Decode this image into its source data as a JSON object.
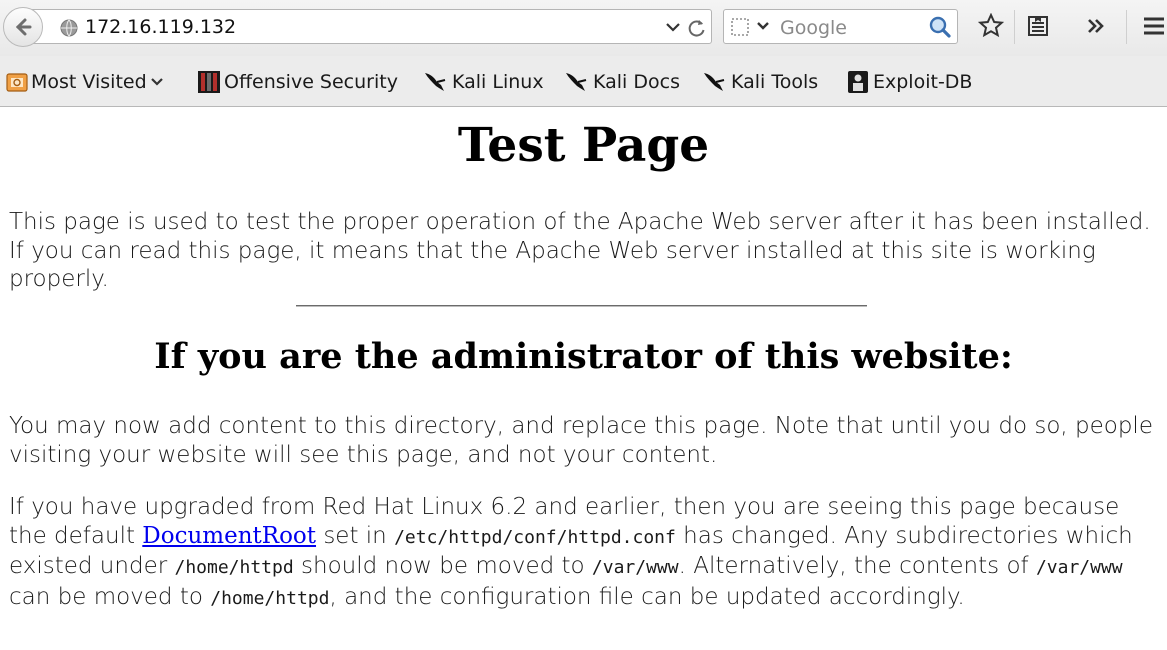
{
  "browser": {
    "url": "172.16.119.132",
    "search_placeholder": "Google"
  },
  "bookmarks": [
    {
      "label": "Most Visited",
      "icon": "most-visited-icon"
    },
    {
      "label": "Offensive Security",
      "icon": "offensive-security-icon"
    },
    {
      "label": "Kali Linux",
      "icon": "kali-dragon-icon"
    },
    {
      "label": "Kali Docs",
      "icon": "kali-dragon-icon"
    },
    {
      "label": "Kali Tools",
      "icon": "kali-dragon-icon"
    },
    {
      "label": "Exploit-DB",
      "icon": "exploit-db-icon"
    }
  ],
  "page": {
    "title": "Test Page",
    "intro": "This page is used to test the proper operation of the Apache Web server after it has been installed. If you can read this page, it means that the Apache Web server installed at this site is working properly.",
    "admin_heading": "If you are the administrator of this website:",
    "admin_para": "You may now add content to this directory, and replace this page. Note that until you do so, people visiting your website will see this page, and not your content.",
    "upgrade": {
      "t1": "If you have upgraded from Red Hat Linux 6.2 and earlier, then you are seeing this page because the default ",
      "link": "DocumentRoot",
      "t2": " set in ",
      "code1": "/etc/httpd/conf/httpd.conf",
      "t3": " has changed. Any subdirectories which existed under ",
      "code2": "/home/httpd",
      "t4": " should now be moved to ",
      "code3": "/var/www",
      "t5": ". Alternatively, the contents of ",
      "code4": "/var/www",
      "t6": " can be moved to ",
      "code5": "/home/httpd",
      "t7": ", and the configuration file can be updated accordingly."
    }
  }
}
